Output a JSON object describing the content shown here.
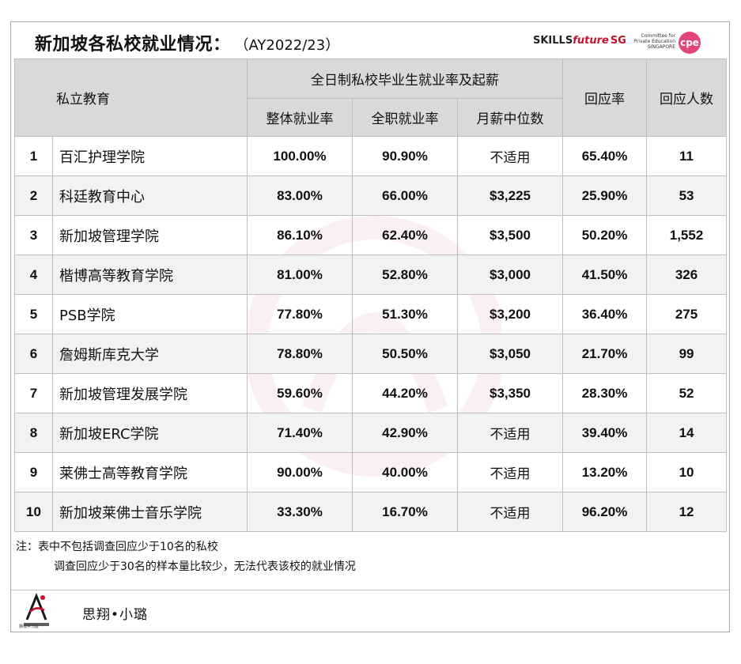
{
  "header": {
    "title": "新加坡各私校就业情况：",
    "subtitle": "（AY2022/23）",
    "logo_skills": "SKILLS",
    "logo_future": "future",
    "logo_sg": "SG",
    "logo_cpe_text": "Committee for Private Education SINGAPORE",
    "logo_cpe_mark": "cpe"
  },
  "table": {
    "col_school": "私立教育",
    "group_header": "全日制私校毕业生就业率及起薪",
    "col_overall": "整体就业率",
    "col_fulltime": "全职就业率",
    "col_salary": "月薪中位数",
    "col_response_rate": "回应率",
    "col_respondents": "回应人数",
    "rows": [
      {
        "rank": "1",
        "name": "百汇护理学院",
        "overall": "100.00%",
        "fulltime": "90.90%",
        "salary": "不适用",
        "rate": "65.40%",
        "count": "11"
      },
      {
        "rank": "2",
        "name": "科廷教育中心",
        "overall": "83.00%",
        "fulltime": "66.00%",
        "salary": "$3,225",
        "rate": "25.90%",
        "count": "53"
      },
      {
        "rank": "3",
        "name": "新加坡管理学院",
        "overall": "86.10%",
        "fulltime": "62.40%",
        "salary": "$3,500",
        "rate": "50.20%",
        "count": "1,552"
      },
      {
        "rank": "4",
        "name": "楷博高等教育学院",
        "overall": "81.00%",
        "fulltime": "52.80%",
        "salary": "$3,000",
        "rate": "41.50%",
        "count": "326"
      },
      {
        "rank": "5",
        "name": "PSB学院",
        "overall": "77.80%",
        "fulltime": "51.30%",
        "salary": "$3,200",
        "rate": "36.40%",
        "count": "275"
      },
      {
        "rank": "6",
        "name": "詹姆斯库克大学",
        "overall": "78.80%",
        "fulltime": "50.50%",
        "salary": "$3,050",
        "rate": "21.70%",
        "count": "99"
      },
      {
        "rank": "7",
        "name": "新加坡管理发展学院",
        "overall": "59.60%",
        "fulltime": "44.20%",
        "salary": "$3,350",
        "rate": "28.30%",
        "count": "52"
      },
      {
        "rank": "8",
        "name": "新加坡ERC学院",
        "overall": "71.40%",
        "fulltime": "42.90%",
        "salary": "不适用",
        "rate": "39.40%",
        "count": "14"
      },
      {
        "rank": "9",
        "name": "莱佛士高等教育学院",
        "overall": "90.00%",
        "fulltime": "40.00%",
        "salary": "不适用",
        "rate": "13.20%",
        "count": "10"
      },
      {
        "rank": "10",
        "name": "新加坡莱佛士音乐学院",
        "overall": "33.30%",
        "fulltime": "16.70%",
        "salary": "不适用",
        "rate": "96.20%",
        "count": "12"
      }
    ]
  },
  "notes": {
    "line1": "注：表中不包括调查回应少于10名的私校",
    "line2": "调查回应少于30名的样本量比较少，无法代表该校的就业情况"
  },
  "footer": {
    "logo_caption": "狮城学习屋",
    "author": "思翔•小璐"
  }
}
